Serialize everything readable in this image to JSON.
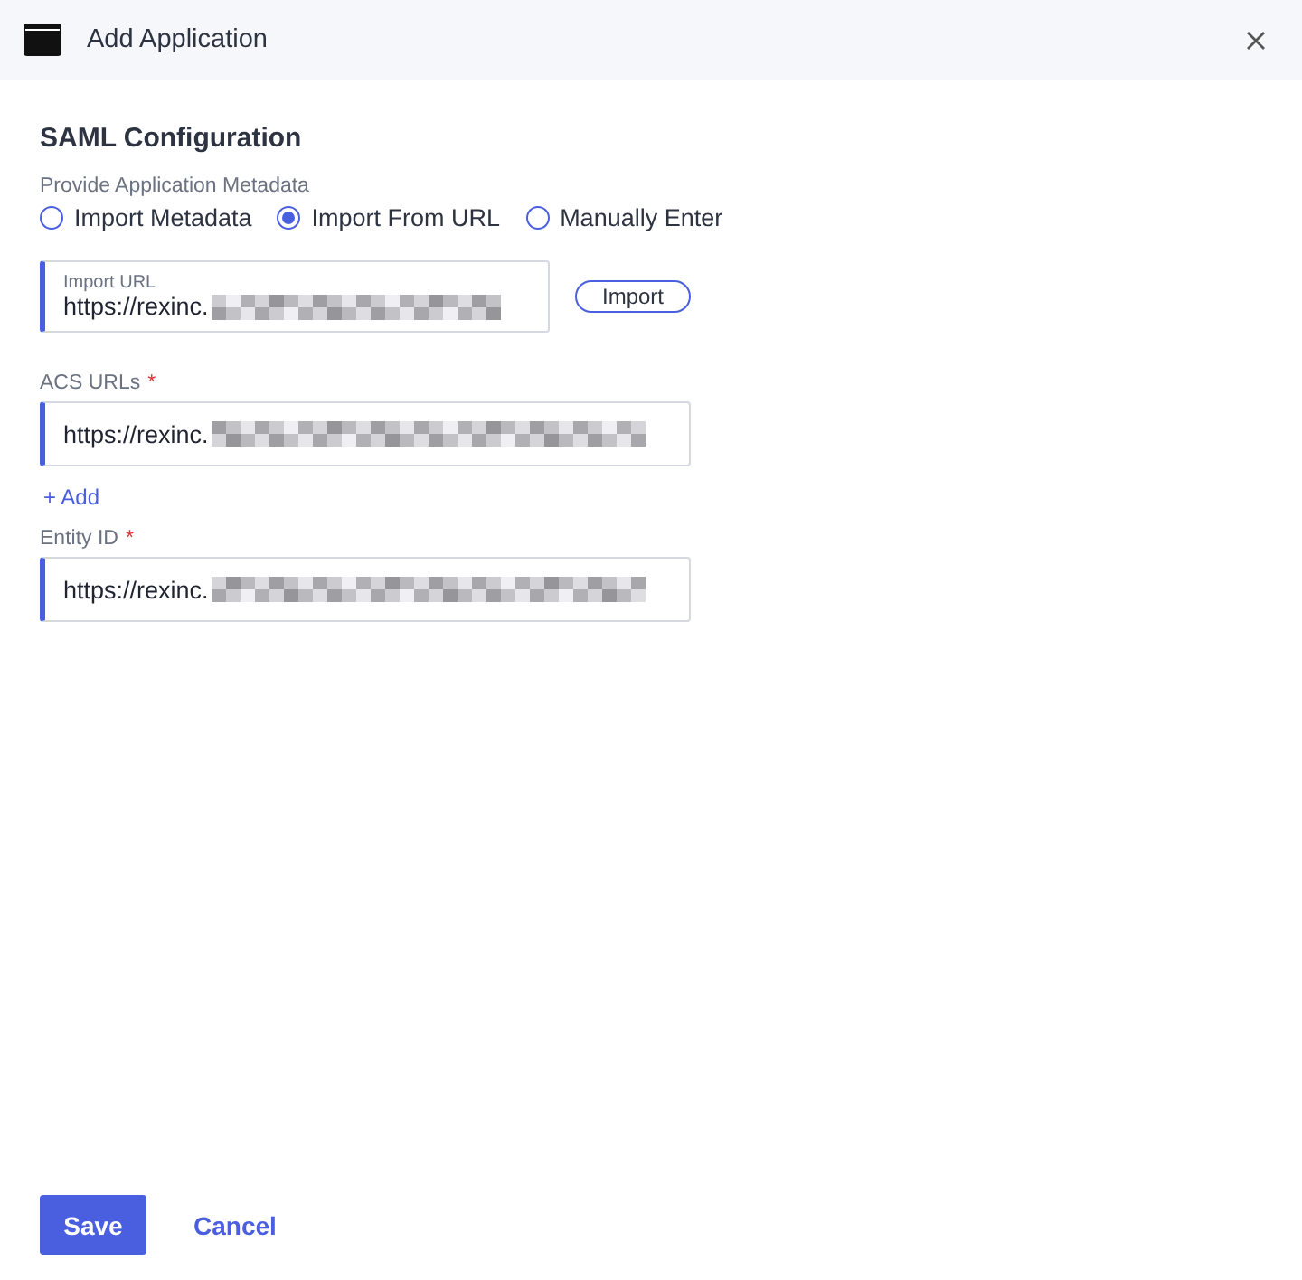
{
  "window": {
    "title": "Add Application"
  },
  "section": {
    "title": "SAML Configuration"
  },
  "metadata": {
    "label": "Provide Application Metadata",
    "options": [
      {
        "label": "Import Metadata",
        "selected": false
      },
      {
        "label": "Import From URL",
        "selected": true
      },
      {
        "label": "Manually Enter",
        "selected": false
      }
    ]
  },
  "import_url": {
    "label": "Import URL",
    "value": "https://rexinc.",
    "button": "Import"
  },
  "acs_urls": {
    "label": "ACS URLs",
    "required": "*",
    "value": "https://rexinc.",
    "add": "+ Add"
  },
  "entity_id": {
    "label": "Entity ID",
    "required": "*",
    "value": "https://rexinc."
  },
  "buttons": {
    "save": "Save",
    "cancel": "Cancel"
  }
}
